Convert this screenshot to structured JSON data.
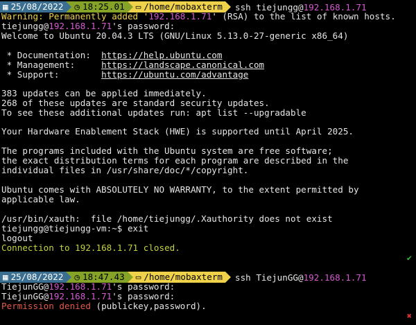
{
  "session1": {
    "prompt": {
      "date": "25/08/2022",
      "time": "18:25.01",
      "path": "/home/mobaxterm",
      "cmd_prefix": "ssh tiejungg@",
      "cmd_ip": "192.168.1.71"
    },
    "lines": {
      "warn_a": "Warning: Permanently added '",
      "warn_ip": "192.168.1.71",
      "warn_b": "' (RSA) to the list of known hosts.",
      "pw_user": "tiejungg@",
      "pw_ip": "192.168.1.71",
      "pw_rest": "'s password:",
      "welcome": "Welcome to Ubuntu 20.04.3 LTS (GNU/Linux 5.13.0-27-generic x86_64)",
      "doc_label": " * Documentation:  ",
      "doc_url": "https://help.ubuntu.com",
      "mgmt_label": " * Management:     ",
      "mgmt_url": "https://landscape.canonical.com",
      "sup_label": " * Support:        ",
      "sup_url": "https://ubuntu.com/advantage",
      "updates1": "383 updates can be applied immediately.",
      "updates2": "268 of these updates are standard security updates.",
      "updates3": "To see these additional updates run: apt list --upgradable",
      "hwe": "Your Hardware Enablement Stack (HWE) is supported until April 2025.",
      "free1": "The programs included with the Ubuntu system are free software;",
      "free2": "the exact distribution terms for each program are described in the",
      "free3": "individual files in /usr/share/doc/*/copyright.",
      "warr1": "Ubuntu comes with ABSOLUTELY NO WARRANTY, to the extent permitted by",
      "warr2": "applicable law.",
      "xauth": "/usr/bin/xauth:  file /home/tiejungg/.Xauthority does not exist",
      "exit": "tiejungg@tiejungg-vm:~$ exit",
      "logout": "logout",
      "closed_a": "Connection to ",
      "closed_ip": "192.168.1.71",
      "closed_b": " closed."
    },
    "status_icon": "check-icon",
    "status_glyph": "✔"
  },
  "session2": {
    "prompt": {
      "date": "25/08/2022",
      "time": "18:47.43",
      "path": "/home/mobaxterm",
      "cmd_prefix": "ssh TiejunGG@",
      "cmd_ip": "192.168.1.71"
    },
    "lines": {
      "pw1_user": "TiejunGG@",
      "pw1_ip": "192.168.1.71",
      "pw1_rest": "'s password:",
      "pw2_user": "TiejunGG@",
      "pw2_ip": "192.168.1.71",
      "pw2_rest": "'s password:",
      "denied_a": "Permission denied",
      "denied_b": " (publickey,password)."
    },
    "status_icon": "cross-icon",
    "status_glyph": "✖"
  },
  "icons": {
    "calendar_glyph": "▦",
    "clock_glyph": "◷",
    "folder_glyph": "▭"
  },
  "colors": {
    "date_segment": "#3a6f92",
    "time_segment": "#84a327",
    "path_segment": "#f0d24a",
    "ip": "#d65bd3",
    "warning": "#f0d24a",
    "connection_closed": "#c4d33a",
    "error": "#e25a4a"
  }
}
